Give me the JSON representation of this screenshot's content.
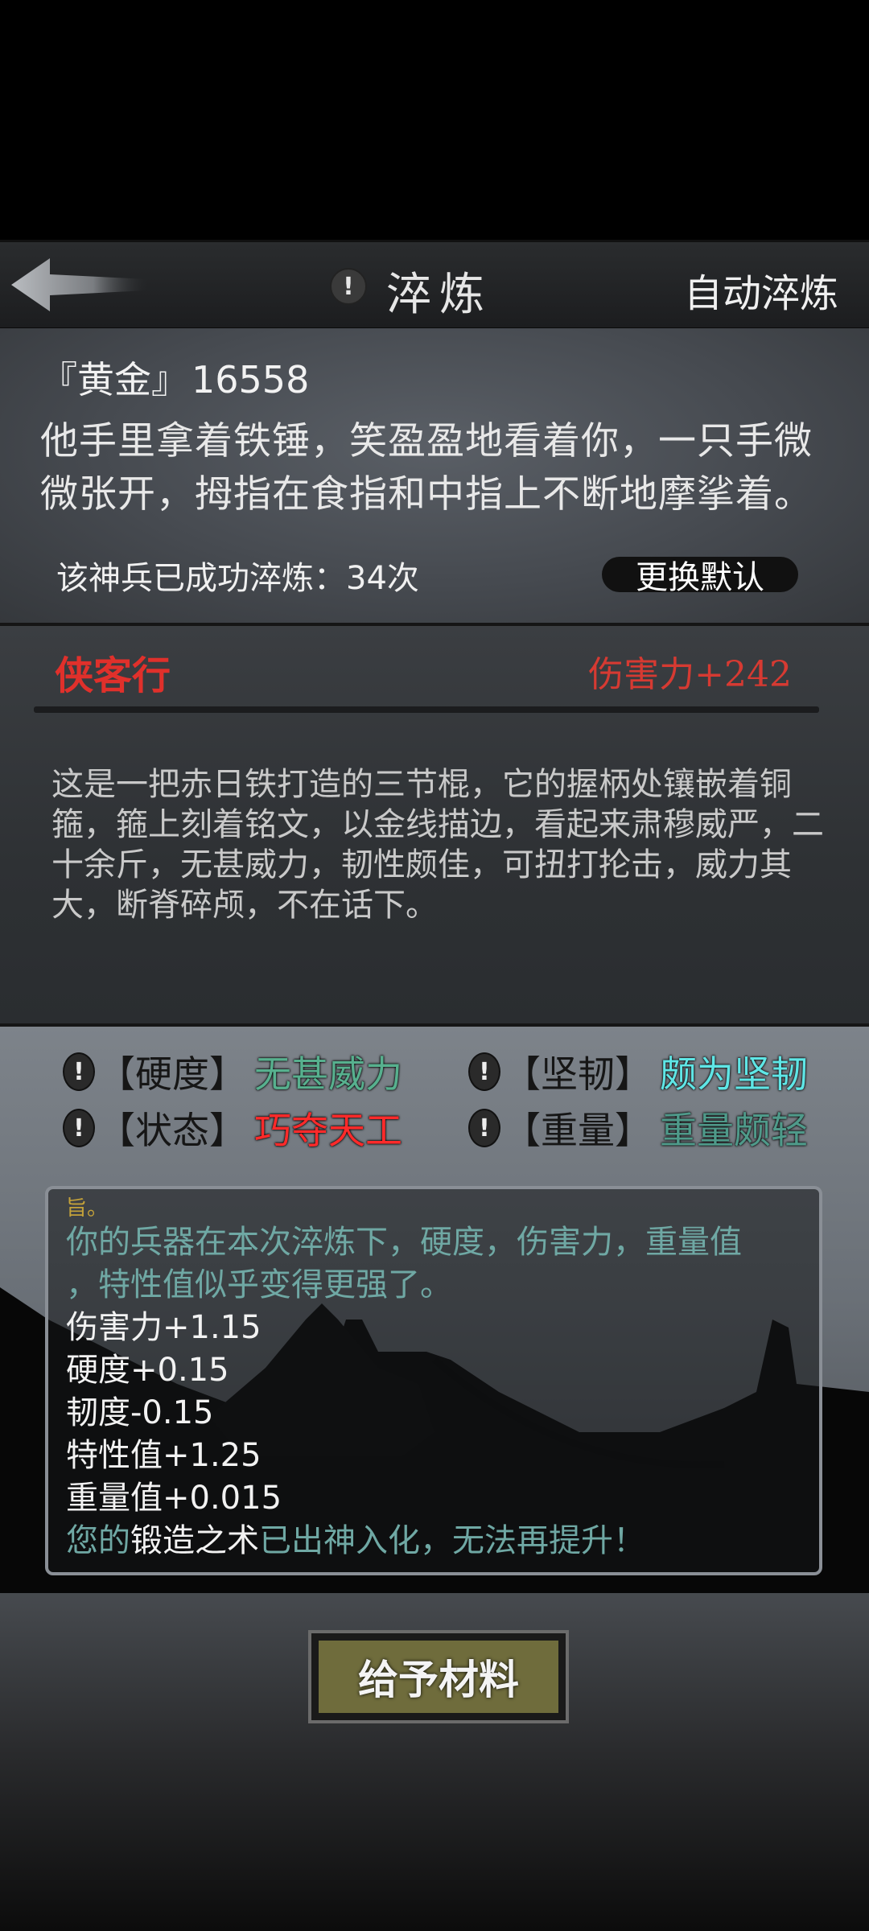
{
  "header": {
    "title": "淬炼",
    "alert_icon": "!",
    "auto_refine": "自动淬炼"
  },
  "item": {
    "name": "『黄金』",
    "number": "16558",
    "description": "他手里拿着铁锤，笑盈盈地看着你，一只手微微张开，拇指在食指和中指上不断地摩挲着。",
    "refine_count": "该神兵已成功淬炼：34次",
    "switch_default": "更换默认"
  },
  "weapon": {
    "name": "侠客行",
    "damage": "伤害力+242",
    "description": "这是一把赤日铁打造的三节棍，它的握柄处镶嵌着铜箍，箍上刻着铭文，以金线描边，看起来肃穆威严，二十余斤，无甚威力，韧性颇佳，可扭打抡击，威力其大，断脊碎颅，不在话下。"
  },
  "attributes": [
    {
      "label": "【硬度】",
      "value": "无甚威力",
      "color": "#57b08e"
    },
    {
      "label": "【坚韧】",
      "value": "颇为坚韧",
      "color": "#5fe6e6"
    },
    {
      "label": "【状态】",
      "value": "巧夺天工",
      "color": "#ff2a2a"
    },
    {
      "label": "【重量】",
      "value": "重量颇轻",
      "color": "#4f9a8a"
    }
  ],
  "log": {
    "head": "旨。",
    "summary_line1": "你的兵器在本次淬炼下，硬度，伤害力，重量值",
    "summary_line2": "，特性值似乎变得更强了。",
    "changes": [
      "伤害力+1.15",
      "硬度+0.15",
      "韧度-0.15",
      "特性值+1.25",
      "重量值+0.015"
    ],
    "final_prefix": "您的",
    "final_skill": "锻造之术",
    "final_suffix": "已出神入化，无法再提升！"
  },
  "give_button": "给予材料"
}
